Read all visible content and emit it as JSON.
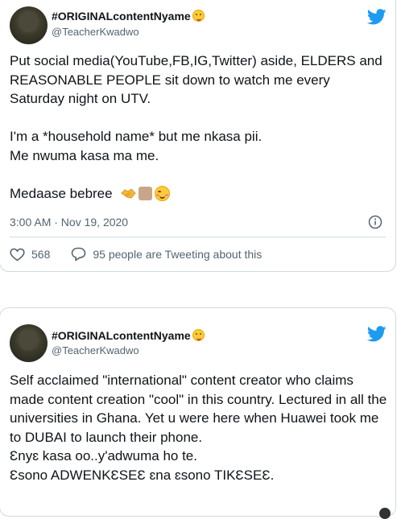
{
  "tweets": [
    {
      "display_name": "#ORIGINALcontentNyame",
      "handle": "@TeacherKwadwo",
      "body": "Put social media(YouTube,FB,IG,Twitter) aside, ELDERS and REASONABLE PEOPLE sit down to watch me every Saturday night on UTV.\n\nI'm a *household name* but me nkasa pii.\nMe nwuma kasa ma me.\n\nMedaase bebree",
      "timestamp": "3:00 AM · Nov 19, 2020",
      "likes": "568",
      "replies_text": "95 people are Tweeting about this"
    },
    {
      "display_name": "#ORIGINALcontentNyame",
      "handle": "@TeacherKwadwo",
      "body": "Self acclaimed \"international\" content creator who claims made content creation \"cool\" in this country. Lectured in all the universities in Ghana. Yet u were here when Huawei took me to DUBAI to launch their phone.\nƐnyɛ kasa oo..y'adwuma ho te.\nƐsono ADWENKƐSEƐ ɛna ɛsono TIKƐSEƐ."
    }
  ],
  "icons": {
    "brand": "twitter-bird-icon",
    "info": "info-icon",
    "like": "heart-icon",
    "reply": "speech-bubble-icon",
    "name_emoji": "zany-face-emoji",
    "body_emojis": [
      "handshake-emoji",
      "skin-tone-square-emoji",
      "smiling-face-emoji"
    ]
  },
  "colors": {
    "brand_blue": "#1d9bf0",
    "text_primary": "#0f1419",
    "text_secondary": "#536471",
    "border": "#cfd9de"
  }
}
